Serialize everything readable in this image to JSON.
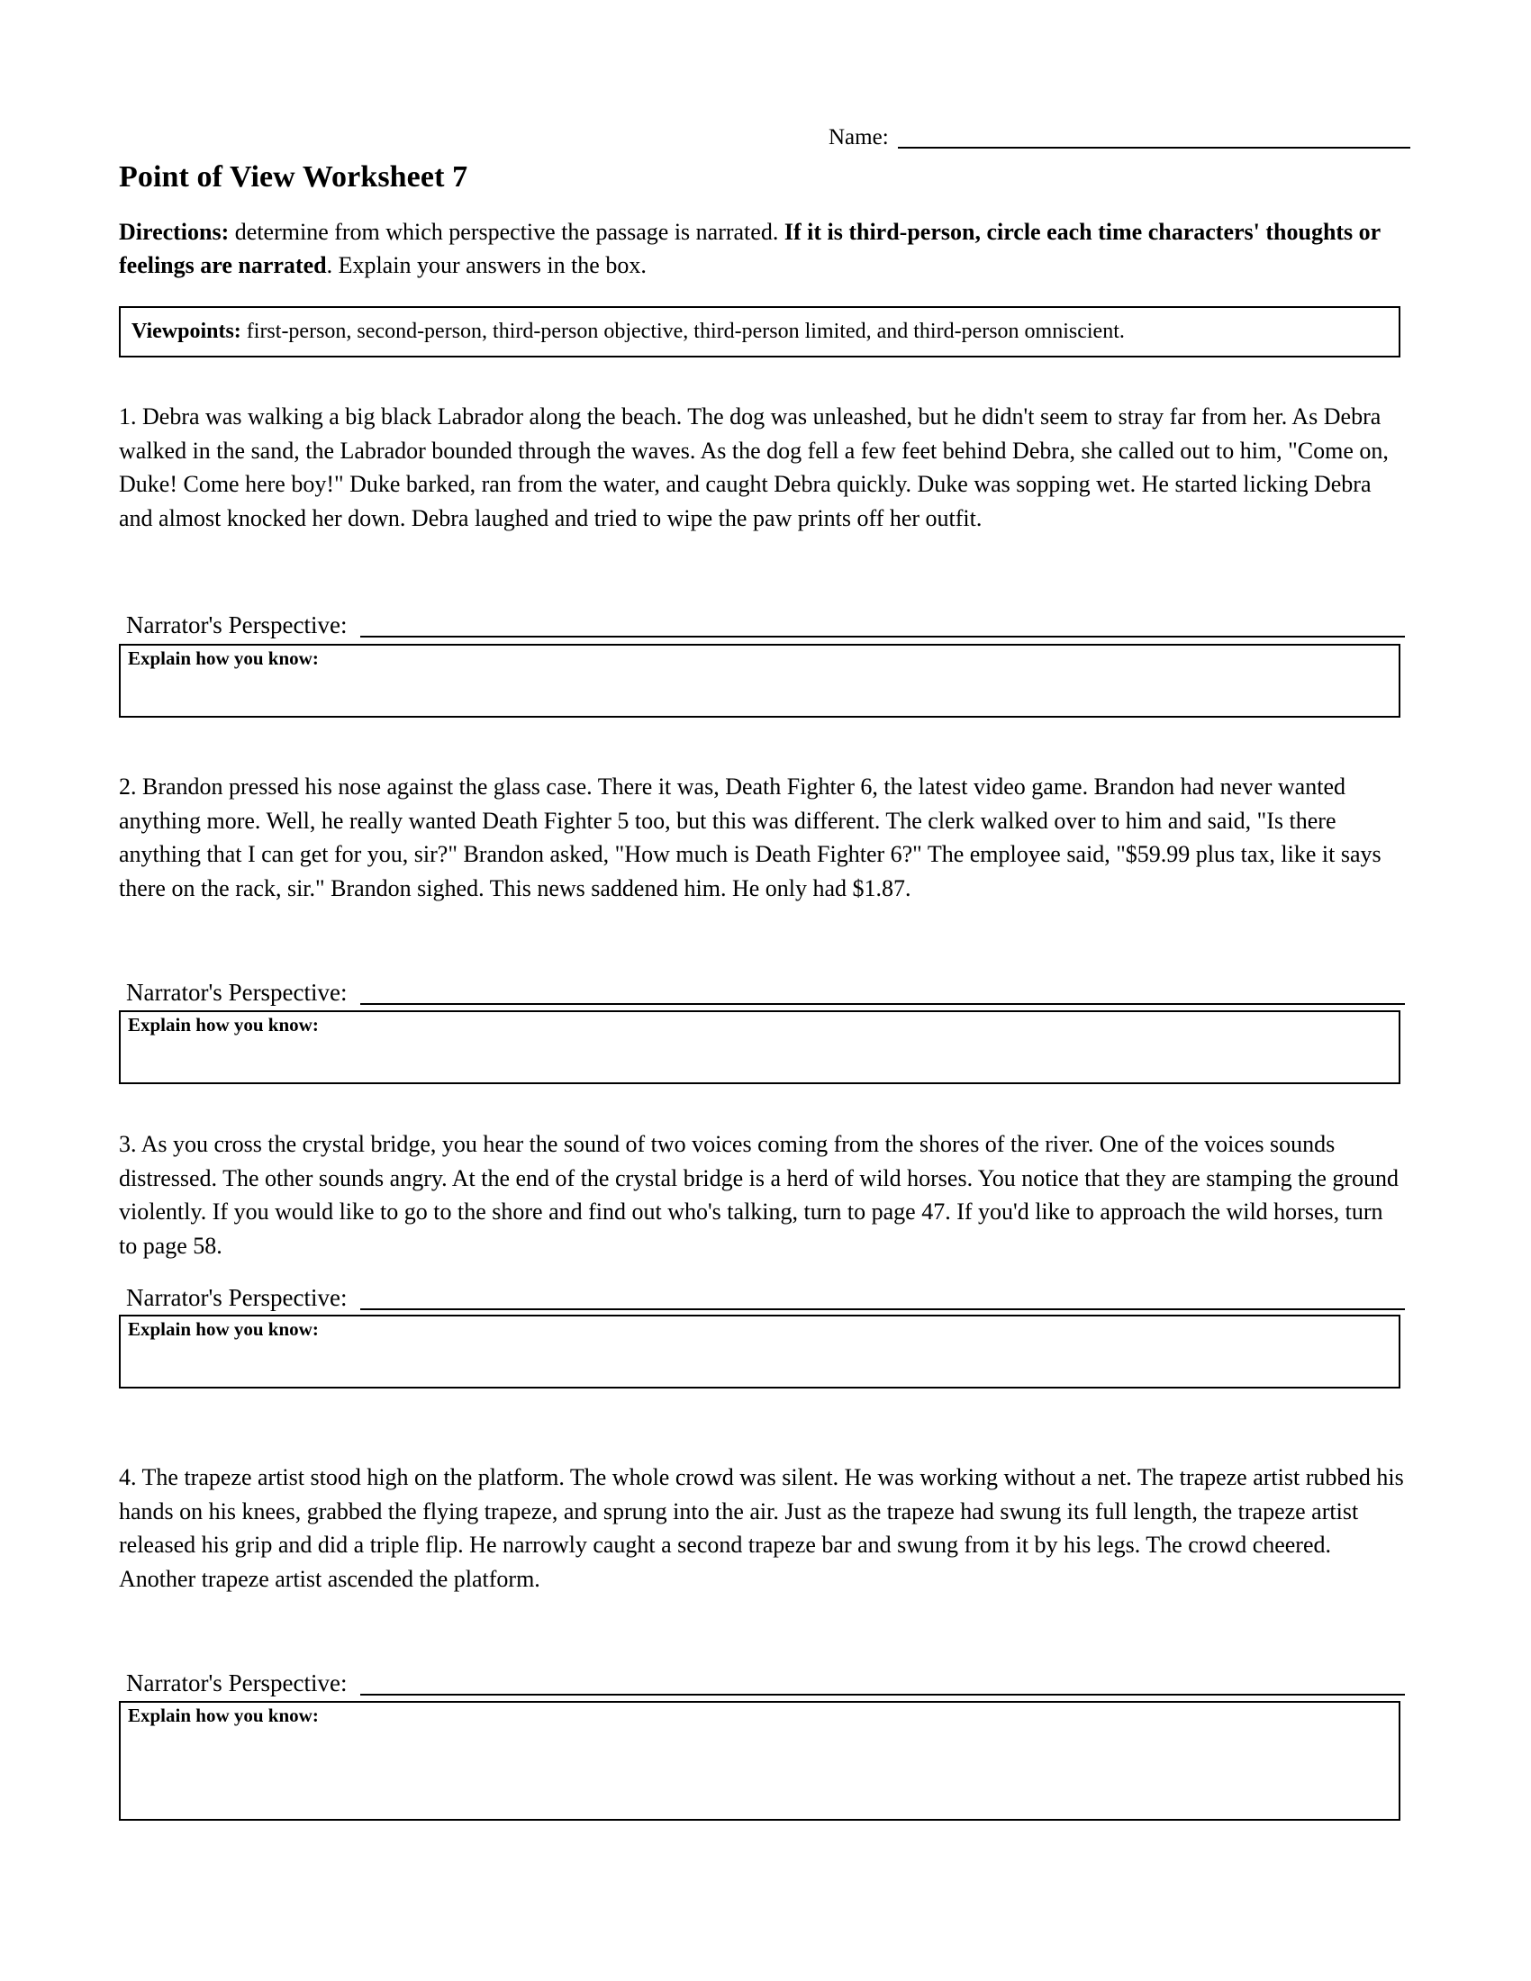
{
  "header": {
    "name_label": "Name:",
    "title": "Point of View Worksheet 7"
  },
  "directions": {
    "label": "Directions:",
    "text_part1": " determine from which perspective the passage is narrated. ",
    "bold_part": "If it is third-person, circle each time characters' thoughts or feelings are narrated",
    "text_part2": ". Explain your answers in the box."
  },
  "viewpoints": {
    "label": "Viewpoints:",
    "list": " first-person, second-person, third-person objective, third-person limited, and third-person omniscient."
  },
  "answer": {
    "perspective_label": "Narrator's Perspective:",
    "explain_label": "Explain how you know:"
  },
  "passages": [
    {
      "number": "1.",
      "text": "1. Debra was walking a big black Labrador along the beach. The dog was unleashed, but he didn't seem to stray far from her. As Debra walked in the sand, the Labrador bounded through the waves. As the dog fell a few feet behind Debra, she called out to him, \"Come on, Duke! Come here boy!\" Duke barked, ran from the water, and caught Debra quickly. Duke was sopping wet. He started licking Debra and almost knocked her down. Debra laughed and tried to wipe the paw prints off her outfit."
    },
    {
      "number": "2.",
      "text": "2. Brandon pressed his nose against the glass case. There it was, Death Fighter 6, the latest video game. Brandon had never wanted anything more. Well, he really wanted Death Fighter 5 too, but this was different. The clerk walked over to him and said, \"Is there anything that I can get for you, sir?\" Brandon asked, \"How much is Death Fighter 6?\" The employee said, \"$59.99 plus tax, like it says there on the rack, sir.\" Brandon sighed. This news saddened him. He only had $1.87."
    },
    {
      "number": "3.",
      "text": "3. As you cross the crystal bridge, you hear the sound of two voices coming from the shores of the river. One of the voices sounds distressed. The other sounds angry. At the end of the crystal bridge is a herd of wild horses. You notice that they are stamping the ground violently. If you would like to go to the shore and find out who's talking, turn to page 47. If you'd like to approach the wild horses, turn to page 58."
    },
    {
      "number": "4.",
      "text": "4. The trapeze artist stood high on the platform. The whole crowd was silent. He was working without a net. The trapeze artist rubbed his hands on his knees, grabbed the flying trapeze, and sprung into the air. Just as the trapeze had swung its full length, the trapeze artist released his grip and did a triple flip. He narrowly caught a second trapeze bar and swung from it by his legs. The crowd cheered. Another trapeze artist ascended the platform."
    }
  ]
}
